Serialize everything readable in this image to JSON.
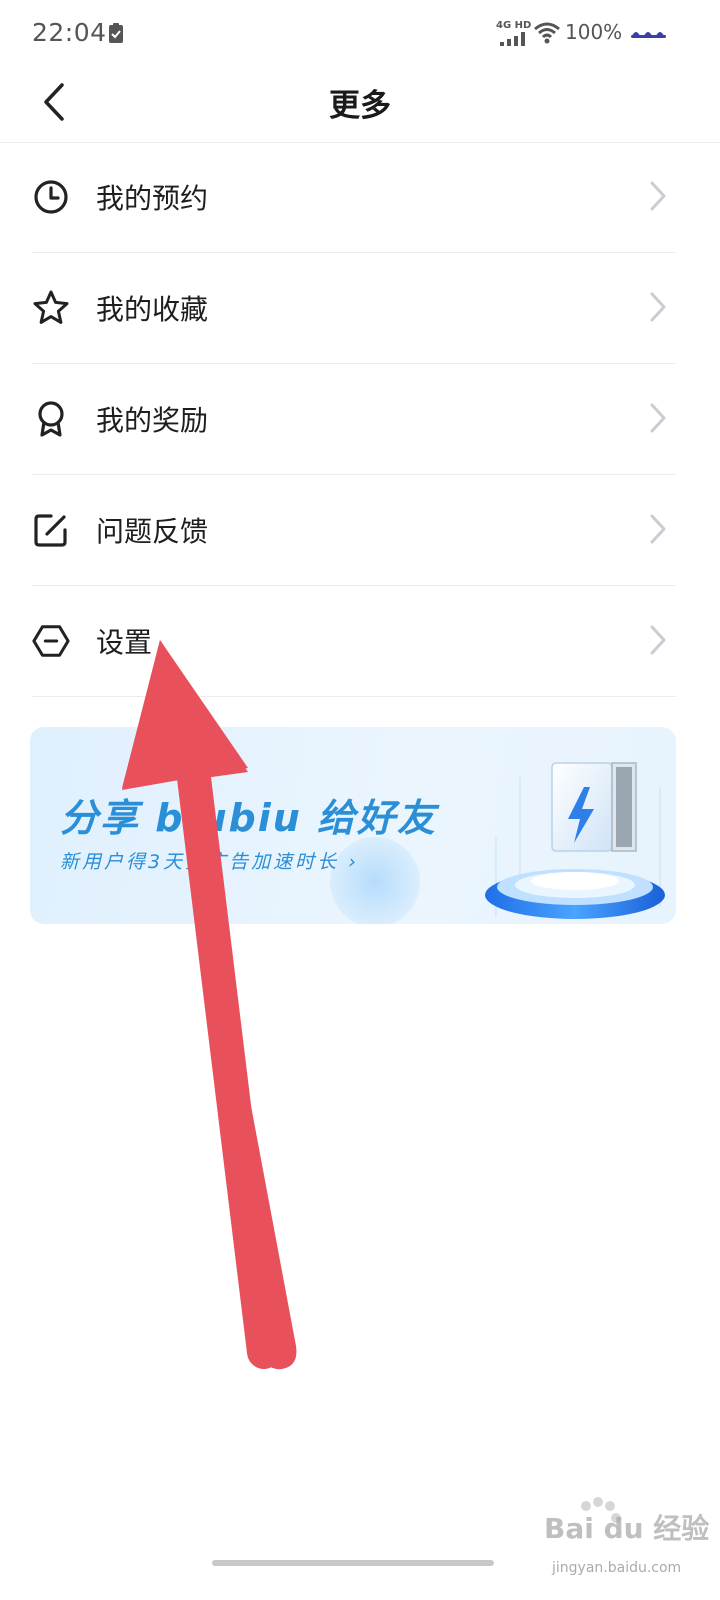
{
  "status_bar": {
    "time": "22:04",
    "network_label": "4G HD",
    "battery": "100%"
  },
  "nav": {
    "title": "更多"
  },
  "menu": {
    "items": [
      {
        "label": "我的预约",
        "icon": "clock-icon"
      },
      {
        "label": "我的收藏",
        "icon": "star-icon"
      },
      {
        "label": "我的奖励",
        "icon": "medal-icon"
      },
      {
        "label": "问题反馈",
        "icon": "edit-icon"
      },
      {
        "label": "设置",
        "icon": "hexagon-minus-icon"
      }
    ]
  },
  "banner": {
    "title": "分享 biubiu 给好友",
    "subtitle": "新用户得3天免广告加速时长 ›"
  },
  "watermark": {
    "brand": "Bai du 经验",
    "url": "jingyan.baidu.com"
  },
  "colors": {
    "accent_blue": "#2a8fd6",
    "annotation_red": "#e8505b",
    "divider": "#ececec"
  }
}
